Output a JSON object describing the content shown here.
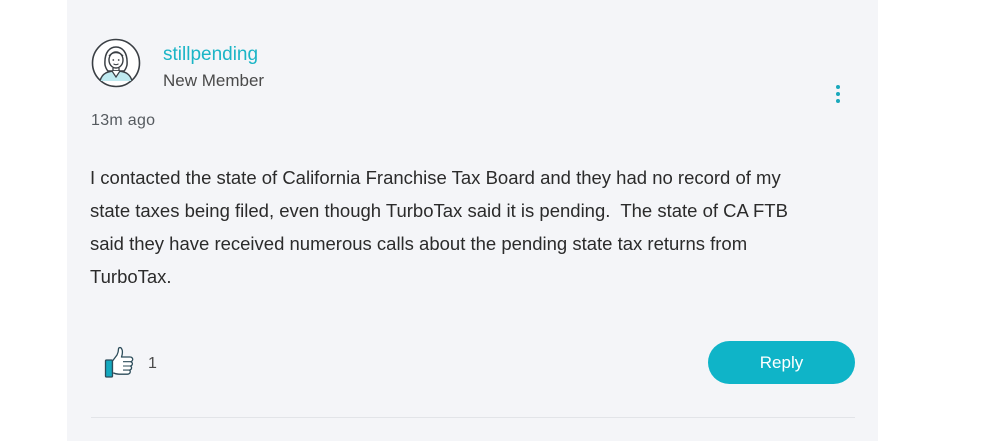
{
  "post": {
    "author": {
      "username": "stillpending",
      "rank": "New Member",
      "avatar_icon": "woman-avatar-icon"
    },
    "timestamp": "13m ago",
    "body": "I contacted the state of California Franchise Tax Board and they had no record of my\nstate taxes being filed, even though TurboTax said it is pending.  The state of CA FTB\nsaid they have received numerous calls about the pending state tax returns from\nTurboTax.",
    "kudos": {
      "icon": "thumbs-up-icon",
      "count": "1"
    },
    "actions": {
      "reply_label": "Reply",
      "options_icon": "kebab-menu-icon"
    }
  },
  "colors": {
    "accent": "#0fb4c8",
    "link": "#1bb5c6",
    "card_background": "#f4f5f8",
    "text": "#2b2b2b"
  }
}
